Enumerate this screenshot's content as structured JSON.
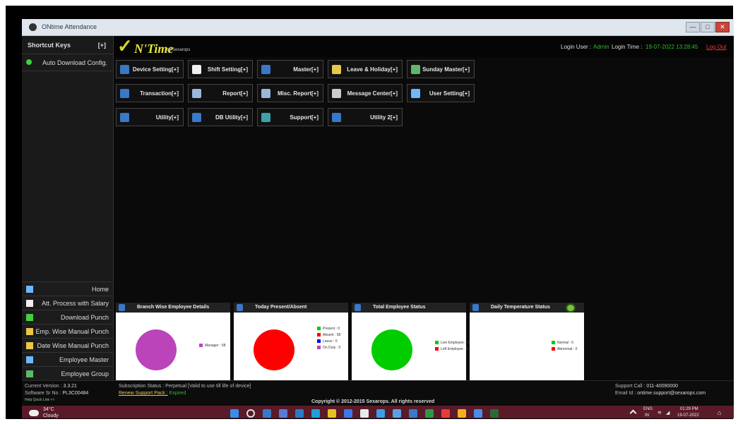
{
  "window": {
    "title": "ONtime Attendance",
    "minimize": "—",
    "maximize": "□",
    "close": "✕"
  },
  "sidebar": {
    "shortcut_keys": "Shortcut Keys",
    "shortcut_toggle": "[+]",
    "auto_download": "Auto Download Config.",
    "items": [
      {
        "label": "Home",
        "icon": "home-icon",
        "color": "#6fb7ff"
      },
      {
        "label": "Att. Process with Salary",
        "icon": "calendar-icon",
        "color": "#f0f0f0"
      },
      {
        "label": "Download Punch",
        "icon": "download-icon",
        "color": "#3fd13f"
      },
      {
        "label": "Emp. Wise Manual Punch",
        "icon": "user-icon",
        "color": "#e8c848"
      },
      {
        "label": "Date Wise Manual Punch",
        "icon": "hand-icon",
        "color": "#e8c848"
      },
      {
        "label": "Employee Master",
        "icon": "person-icon",
        "color": "#6fb7ff"
      },
      {
        "label": "Employee Group",
        "icon": "group-icon",
        "color": "#5fb86a"
      }
    ]
  },
  "header": {
    "logo_mark": "✓",
    "logo_text": "N'Time",
    "logo_by": "by Sexarops",
    "login_user_label": "Login User :",
    "login_user": "Admin",
    "login_time_label": "Login Time :",
    "login_time": "19-07-2022 13:28:45",
    "logout": "Log Out"
  },
  "modules": [
    {
      "label": "Device Setting[+]",
      "icon": "device-icon",
      "color": "#3a78c8"
    },
    {
      "label": "Shift Setting[+]",
      "icon": "clock-icon",
      "color": "#f0f0f0"
    },
    {
      "label": "Master[+]",
      "icon": "master-icon",
      "color": "#3a78c8"
    },
    {
      "label": "Leave & Holiday[+]",
      "icon": "leave-icon",
      "color": "#e8c848"
    },
    {
      "label": "Sunday Master[+]",
      "icon": "money-icon",
      "color": "#5fb86a"
    },
    {
      "label": "Transaction[+]",
      "icon": "transaction-icon",
      "color": "#3a78c8"
    },
    {
      "label": "Report[+]",
      "icon": "report-icon",
      "color": "#9ab7dc"
    },
    {
      "label": "Misc. Report[+]",
      "icon": "misc-report-icon",
      "color": "#9ab7dc"
    },
    {
      "label": "Message Center[+]",
      "icon": "message-icon",
      "color": "#cccccc"
    },
    {
      "label": "User Setting[+]",
      "icon": "user-setting-icon",
      "color": "#6fb7ff"
    },
    {
      "label": "Utility[+]",
      "icon": "utility-icon",
      "color": "#3a78c8"
    },
    {
      "label": "DB Utility[+]",
      "icon": "db-icon",
      "color": "#3a78c8"
    },
    {
      "label": "Support[+]",
      "icon": "support-icon",
      "color": "#3fa0a8"
    },
    {
      "label": "Utility 2[+]",
      "icon": "utility2-icon",
      "color": "#3a78c8"
    }
  ],
  "panels": [
    {
      "title": "Branch Wise Employee Details",
      "pie_color": "#bb44bb",
      "legend": [
        {
          "label": "Manager : 58",
          "color": "#bb44bb"
        }
      ]
    },
    {
      "title": "Today Present/Absent",
      "pie_color": "#ff0000",
      "legend": [
        {
          "label": "Present : 0",
          "color": "#00cc00"
        },
        {
          "label": "Absent : 58",
          "color": "#ff0000"
        },
        {
          "label": "Leave : 0",
          "color": "#0000ff"
        },
        {
          "label": "On Duty : 0",
          "color": "#bb44bb"
        }
      ]
    },
    {
      "title": "Total Employee Status",
      "pie_color": "#00cc00",
      "legend": [
        {
          "label": "Live Employee : 58",
          "color": "#00cc00"
        },
        {
          "label": "Left Employee : 0",
          "color": "#ff0000"
        }
      ]
    },
    {
      "title": "Daily Temperature Status",
      "pie_color": "#ffffff",
      "legend": [
        {
          "label": "Normal : 0",
          "color": "#00cc00"
        },
        {
          "label": "Abnormal : 0",
          "color": "#ff0000"
        }
      ]
    }
  ],
  "footer": {
    "version_label": "Current Version :",
    "version": "3.3.21",
    "serial_label": "Software Sr No :",
    "serial": "PL3C00484",
    "quick_link": "Help Quick Link <<",
    "subscription": "Subscription Status : Perpetual [Valid to use till life of device]",
    "renew": "Renew Support Pack :",
    "renew_status": "Expired",
    "copyright": "Copyright © 2012-2015 Sexarops. All rights reserved",
    "support_call_label": "Support Call :",
    "support_call": "011-40090000",
    "email_label": "Email Id",
    "email": ": ontime.support@sexarops.com"
  },
  "taskbar": {
    "weather_temp": "34°C",
    "weather_desc": "Cloudy",
    "lang_top": "ENG",
    "lang_bottom": "IN",
    "time": "01:29 PM",
    "date": "19-07-2022"
  }
}
